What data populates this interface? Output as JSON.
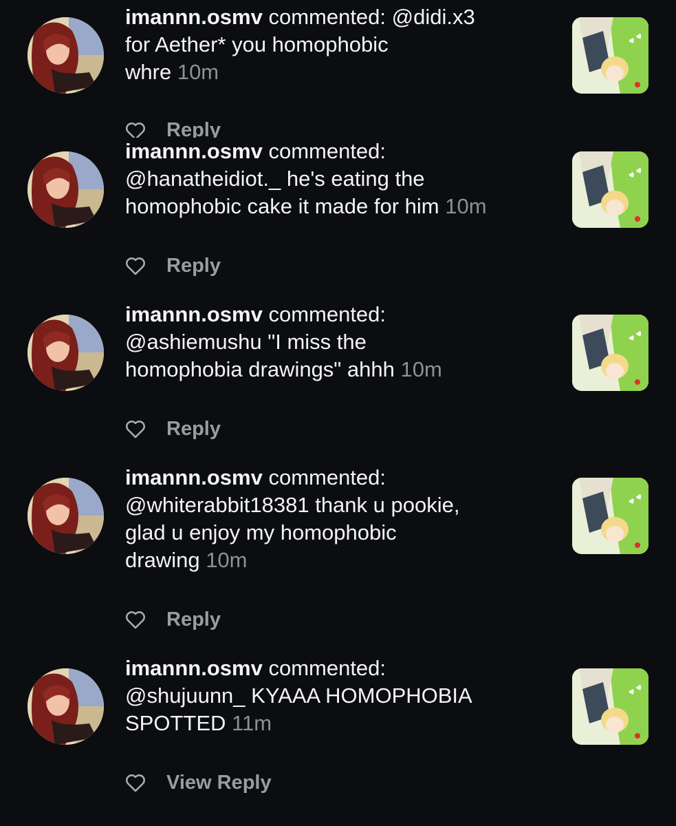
{
  "notifications": [
    {
      "user": "imannn.osmv",
      "verb": "commented:",
      "comment_lines": [
        "@didi.x3",
        "for Aether* you homophobic",
        "whre"
      ],
      "time": "10m",
      "reply_label": "Reply"
    },
    {
      "user": "imannn.osmv",
      "verb": "commented:",
      "comment_lines": [
        "",
        "@hanatheidiot._ he's eating the",
        "homophobic cake it made for him"
      ],
      "time": "10m",
      "reply_label": "Reply"
    },
    {
      "user": "imannn.osmv",
      "verb": "commented:",
      "comment_lines": [
        "",
        "@ashiemushu \"I miss the",
        "homophobia drawings\" ahhh"
      ],
      "time": "10m",
      "reply_label": "Reply"
    },
    {
      "user": "imannn.osmv",
      "verb": "commented:",
      "comment_lines": [
        "",
        "@whiterabbit18381 thank u pookie,",
        "glad u enjoy my homophobic",
        "drawing"
      ],
      "time": "10m",
      "reply_label": "Reply"
    },
    {
      "user": "imannn.osmv",
      "verb": "commented:",
      "comment_lines": [
        "",
        "@shujuunn_ KYAAA HOMOPHOBIA",
        "SPOTTED"
      ],
      "time": "11m",
      "reply_label": "View Reply"
    }
  ],
  "colors": {
    "background": "#0b0d10",
    "text": "#f4f4f4",
    "muted": "#8d9096",
    "reply": "#9a9ca1"
  },
  "icons": {
    "like": "heart-outline-icon",
    "avatar": "anime-girl-avatar",
    "post_thumbnail": "anime-drawing-thumbnail"
  }
}
